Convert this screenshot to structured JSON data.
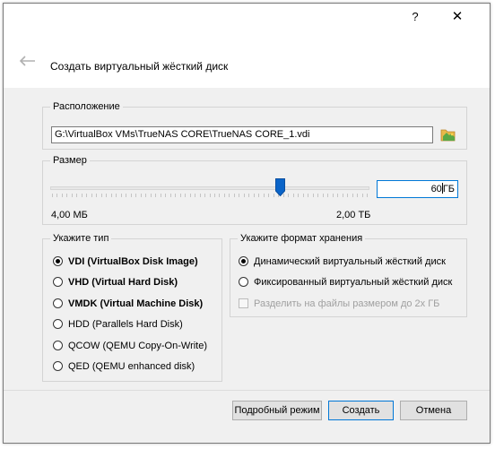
{
  "titlebar": {
    "help_label": "?",
    "close_label": "✕"
  },
  "header": {
    "title": "Создать виртуальный жёсткий диск"
  },
  "location": {
    "group_label": "Расположение",
    "path_value": "G:\\VirtualBox VMs\\TrueNAS CORE\\TrueNAS CORE_1.vdi"
  },
  "size": {
    "group_label": "Размер",
    "value_number": "60",
    "value_unit": "ГБ",
    "min_label": "4,00 МБ",
    "max_label": "2,00 ТБ",
    "slider_fraction": 0.72
  },
  "disk_type": {
    "group_label": "Укажите тип",
    "options": [
      {
        "label": "VDI (VirtualBox Disk Image)",
        "selected": true
      },
      {
        "label": "VHD (Virtual Hard Disk)",
        "selected": false
      },
      {
        "label": "VMDK (Virtual Machine Disk)",
        "selected": false
      },
      {
        "label": "HDD (Parallels Hard Disk)",
        "selected": false
      },
      {
        "label": "QCOW (QEMU Copy-On-Write)",
        "selected": false
      },
      {
        "label": "QED (QEMU enhanced disk)",
        "selected": false
      }
    ]
  },
  "storage_format": {
    "group_label": "Укажите формат хранения",
    "dynamic_label": "Динамический виртуальный жёсткий диск",
    "fixed_label": "Фиксированный виртуальный жёсткий диск",
    "split_label": "Разделить на файлы размером до 2х ГБ"
  },
  "buttons": {
    "expert": "Подробный режим",
    "create": "Создать",
    "cancel": "Отмена"
  },
  "colors": {
    "accent": "#0078d7",
    "slider_thumb": "#0a64c8"
  },
  "icons": {
    "back": "back-arrow-icon",
    "folder": "folder-icon",
    "close": "close-icon",
    "help": "help-icon"
  }
}
